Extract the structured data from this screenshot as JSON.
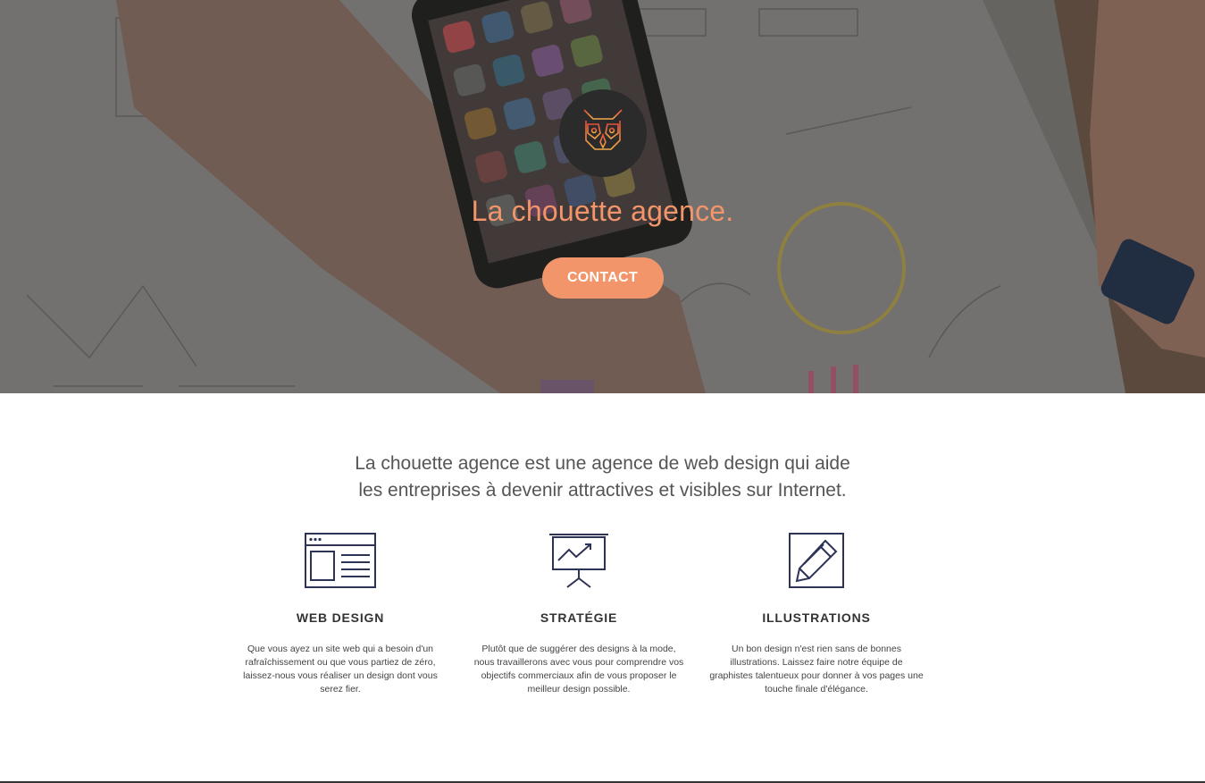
{
  "hero": {
    "title": "La chouette agence.",
    "contact_label": "CONTACT"
  },
  "intro": {
    "line1": "La chouette agence est une agence de web design qui aide",
    "line2": "les entreprises à devenir attractives et visibles sur Internet."
  },
  "services": [
    {
      "icon": "browser-window-icon",
      "title": "WEB DESIGN",
      "description": "Que vous ayez un site web qui a besoin d'un rafraîchissement ou que vous partiez de zéro, laissez-nous vous réaliser un design dont vous serez fier."
    },
    {
      "icon": "presentation-chart-icon",
      "title": "STRATÉGIE",
      "description": "Plutôt que de suggérer des designs à la mode, nous travaillerons avec vous pour comprendre vos objectifs commerciaux afin de vous proposer le meilleur design possible."
    },
    {
      "icon": "pencil-square-icon",
      "title": "ILLUSTRATIONS",
      "description": "Un bon design n'est rien sans de bonnes illustrations. Laissez faire notre équipe de graphistes talentueux pour donner à vos pages une touche finale d'élégance."
    }
  ],
  "colors": {
    "accent": "#f3956a",
    "icon_stroke": "#2c3355",
    "logo_bg": "#2b2b2b"
  }
}
